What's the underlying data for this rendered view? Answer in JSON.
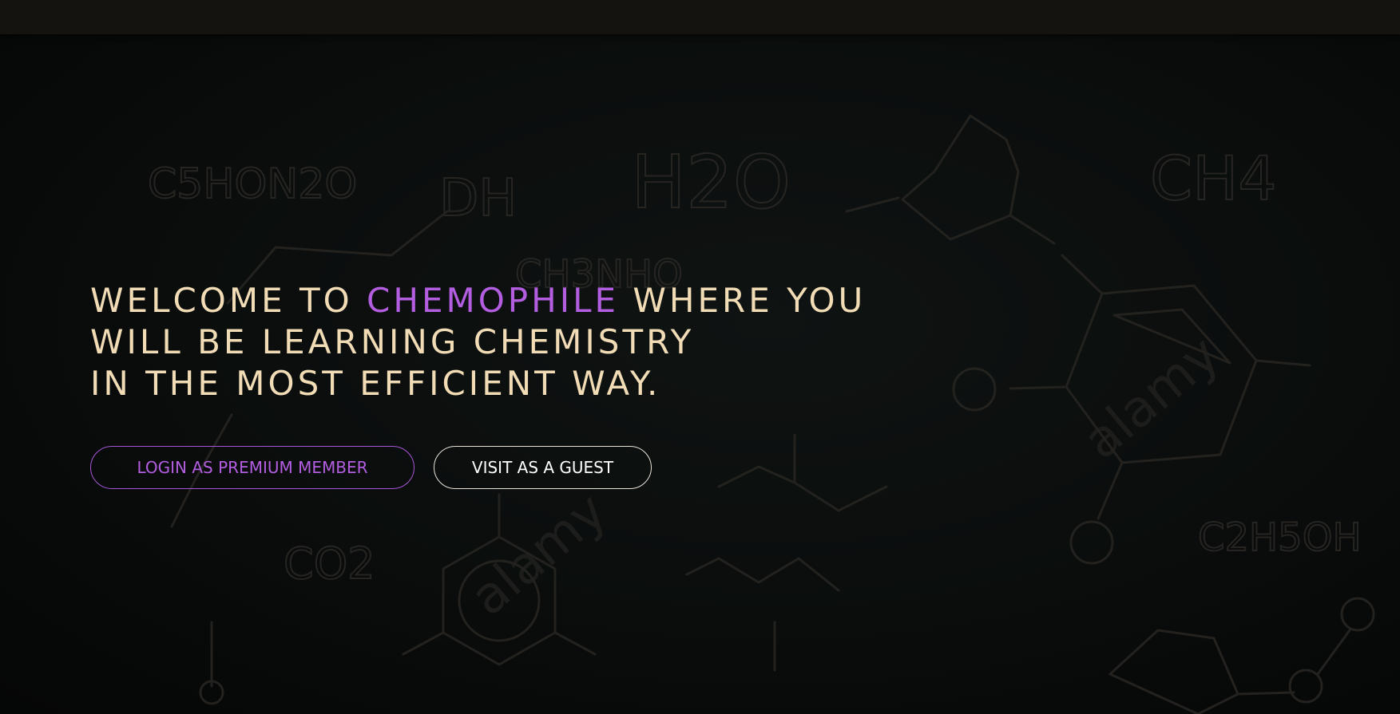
{
  "hero": {
    "line1_prefix": "WELCOME TO ",
    "brand": "CHEMOPHILE",
    "line1_suffix": " WHERE YOU",
    "line2": "WILL BE LEARNING CHEMISTRY",
    "line3": "IN THE MOST EFFICIENT WAY."
  },
  "actions": {
    "premium_label": "LOGIN AS PREMIUM MEMBER",
    "guest_label": "VISIT AS A GUEST"
  },
  "background": {
    "formulas": [
      "C5HON2O",
      "DH",
      "H2O",
      "CH4",
      "CH3NHO",
      "CO2",
      "C2H5OH"
    ],
    "watermark": "alamy"
  },
  "colors": {
    "headline": "#f1dcb6",
    "accent": "#b35ee0",
    "guest_border": "#e8e3da",
    "background": "#0a0d0c",
    "topbar": "#15130f"
  }
}
